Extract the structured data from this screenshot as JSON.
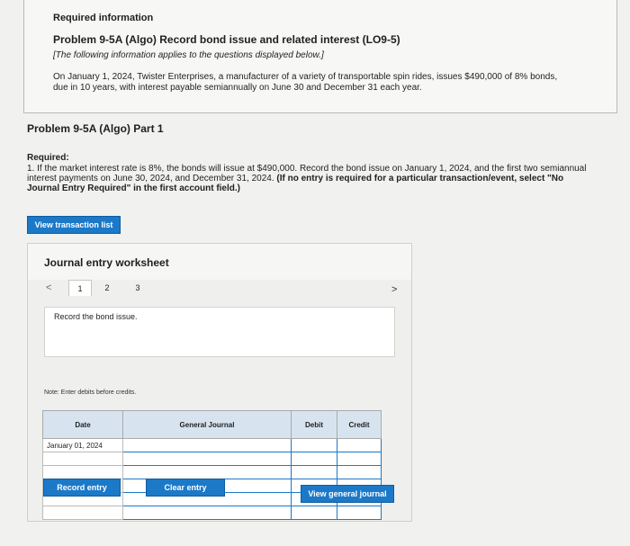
{
  "info": {
    "required_title": "Required information",
    "problem_title": "Problem 9-5A (Algo) Record bond issue and related interest (LO9-5)",
    "note": "[The following information applies to the questions displayed below.]",
    "description": "On January 1, 2024, Twister Enterprises, a manufacturer of a variety of transportable spin rides, issues $490,000 of 8% bonds, due in 10 years, with interest payable semiannually on June 30 and December 31 each year."
  },
  "part": {
    "title": "Problem 9-5A (Algo) Part 1",
    "required_label": "Required:",
    "required_text": "1. If the market interest rate is 8%, the bonds will issue at $490,000. Record the bond issue on January 1, 2024, and the first two semiannual interest payments on June 30, 2024, and December 31, 2024.",
    "required_bold": "(If no entry is required for a particular transaction/event, select \"No Journal Entry Required\" in the first account field.)"
  },
  "buttons": {
    "view_transaction_list": "View transaction list",
    "record_entry": "Record entry",
    "clear_entry": "Clear entry",
    "view_general_journal": "View general journal"
  },
  "worksheet": {
    "title": "Journal entry worksheet",
    "nav_prev": "<",
    "nav_next": ">",
    "tabs": [
      "1",
      "2",
      "3"
    ],
    "active_tab": "1",
    "entry_description": "Record the bond issue.",
    "note_debits": "Note: Enter debits before credits.",
    "columns": {
      "date": "Date",
      "general_journal": "General Journal",
      "debit": "Debit",
      "credit": "Credit"
    },
    "rows": [
      {
        "date": "January 01, 2024"
      },
      {
        "date": ""
      },
      {
        "date": ""
      },
      {
        "date": ""
      },
      {
        "date": ""
      },
      {
        "date": ""
      }
    ]
  },
  "colors": {
    "button": "#1b79c8",
    "table_header": "#d7e4f0",
    "background": "#f1f1f0"
  }
}
